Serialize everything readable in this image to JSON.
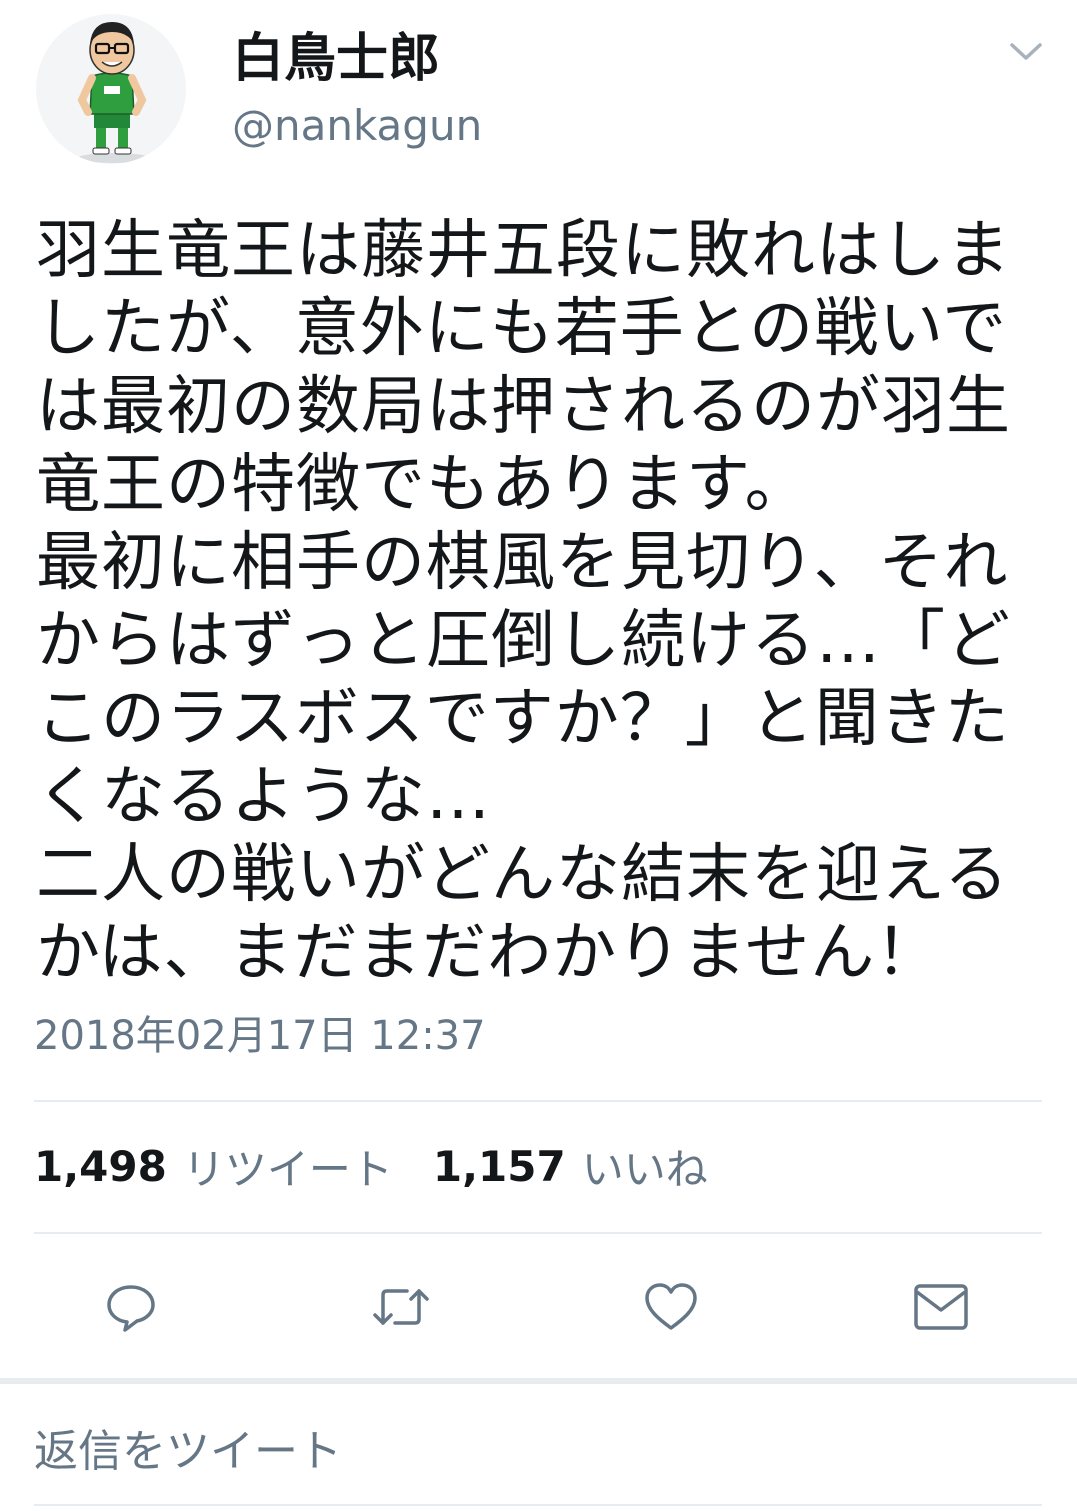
{
  "user": {
    "display_name": "白鳥士郎",
    "handle": "@nankagun",
    "avatar_icon": "cartoon-avatar"
  },
  "tweet": {
    "text_lines": [
      "羽生竜王は藤井五段に敗れはしま",
      "したが、意外にも若手との戦いで",
      "は最初の数局は押されるのが羽生",
      "竜王の特徴でもあります。",
      "最初に相手の棋風を見切り、それ",
      "からはずっと圧倒し続ける…「ど",
      "このラスボスですか？」と聞きた",
      "くなるような…",
      "二人の戦いがどんな結末を迎える",
      "かは、まだまだわかりません！"
    ],
    "timestamp": "2018年02月17日 12:37"
  },
  "stats": {
    "retweets_count": "1,498",
    "retweets_label": "リツイート",
    "likes_count": "1,157",
    "likes_label": "いいね"
  },
  "actions": [
    {
      "name": "reply",
      "icon": "speech-bubble-icon"
    },
    {
      "name": "retweet",
      "icon": "retweet-icon"
    },
    {
      "name": "like",
      "icon": "heart-icon"
    },
    {
      "name": "direct-message",
      "icon": "envelope-icon"
    }
  ],
  "reply": {
    "placeholder": "返信をツイート"
  },
  "colors": {
    "text_primary": "#14171a",
    "text_secondary": "#657786",
    "icon": "#657786",
    "divider": "#e6ecf0",
    "avatar_shirt": "#2e9e3f"
  }
}
